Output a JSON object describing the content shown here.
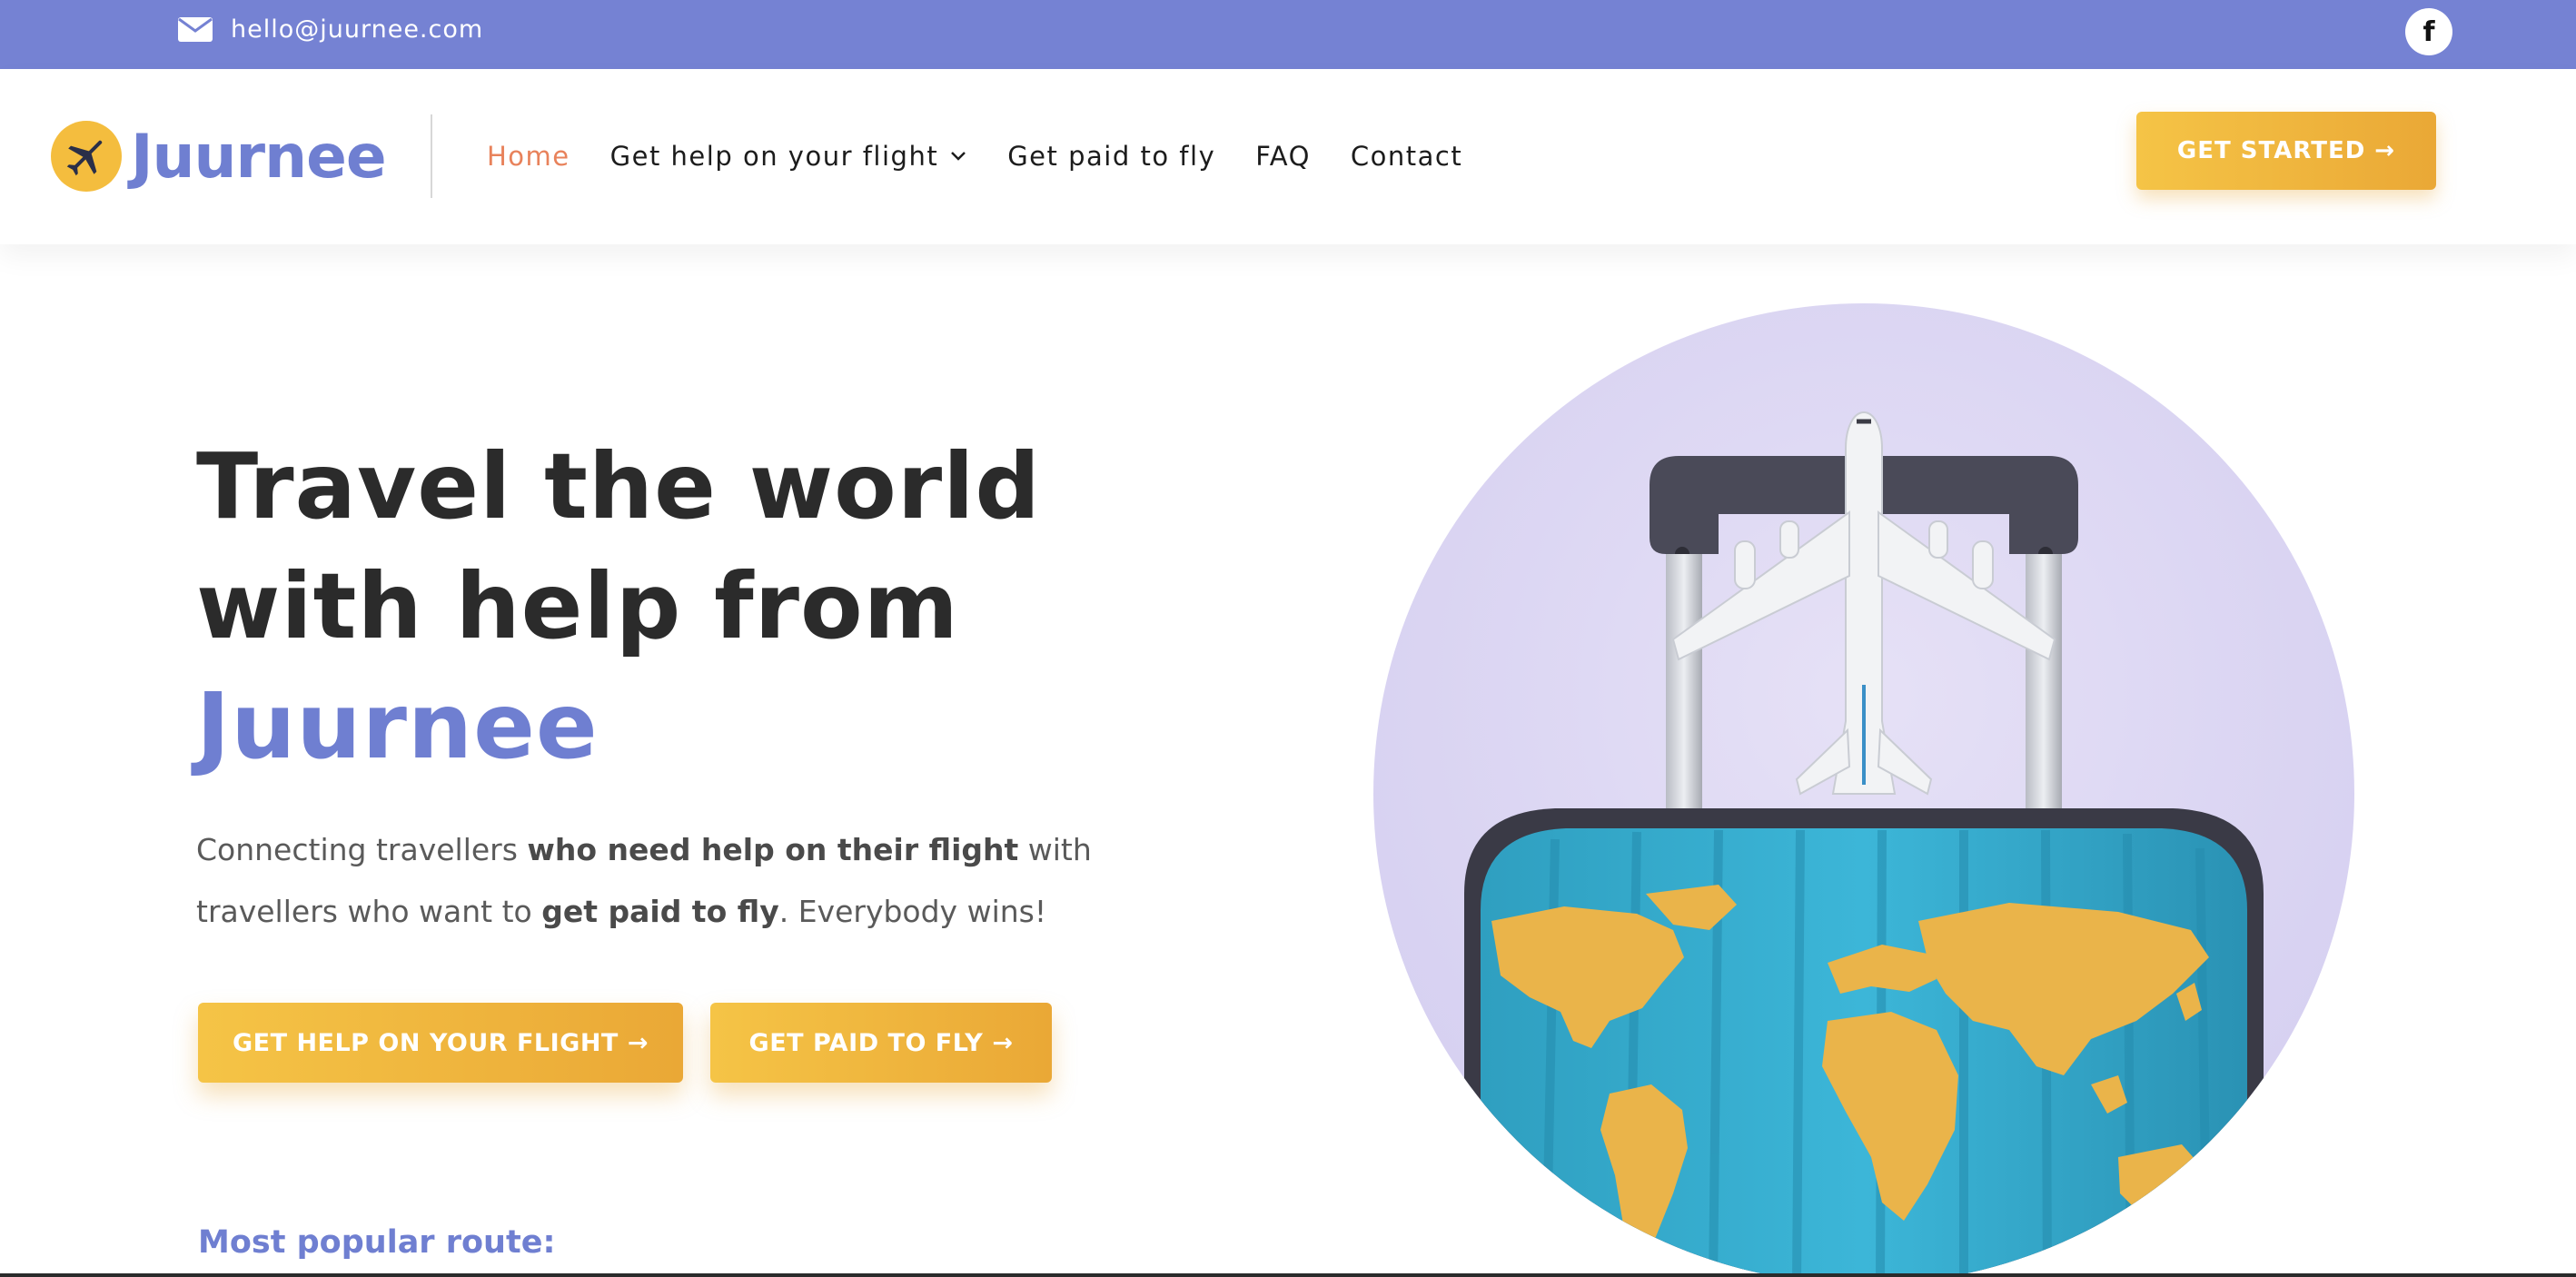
{
  "topbar": {
    "email": "hello@juurnee.com",
    "email_icon": "envelope-icon",
    "social_icon": "facebook-icon",
    "social_glyph": "f",
    "background": "#7582d3"
  },
  "header": {
    "logo_text": "Juurnee",
    "logo_icon": "airplane-icon",
    "nav": [
      {
        "label": "Home",
        "active": true
      },
      {
        "label": "Get help on your flight",
        "has_dropdown": true
      },
      {
        "label": "Get paid to fly"
      },
      {
        "label": "FAQ"
      },
      {
        "label": "Contact"
      }
    ],
    "cta_label": "GET STARTED",
    "arrow": "→"
  },
  "hero": {
    "title_line1": "Travel the world",
    "title_line2": "with help from",
    "title_accent": "Juurnee",
    "subtitle": {
      "part1": "Connecting travellers ",
      "bold1": "who need help on their flight",
      "part2": " with travellers who want to ",
      "bold2": "get paid to fly",
      "part3": ". Everybody wins!"
    },
    "button_help": "GET HELP ON YOUR FLIGHT",
    "button_fly": "GET PAID TO FLY",
    "arrow": "→",
    "popular_route_label": "Most popular route:",
    "image_subject": "toy airplane on world-map suitcase"
  },
  "colors": {
    "accent": "#6f7fd1",
    "active_nav": "#e8825b",
    "button": "#f2b83f",
    "heading": "#2b2b2b"
  }
}
